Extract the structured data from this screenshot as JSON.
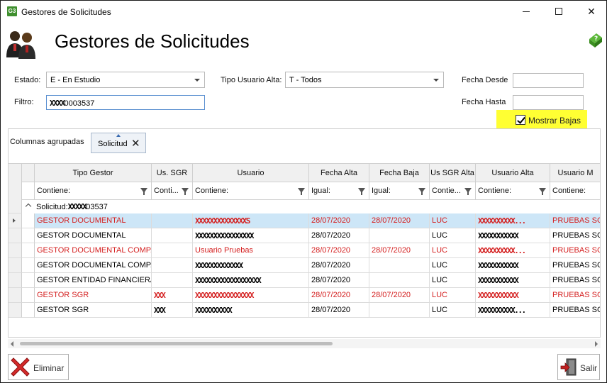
{
  "window": {
    "app_icon_text": "G3",
    "title": "Gestores de Solicitudes"
  },
  "header": {
    "title": "Gestores de Solicitudes"
  },
  "filters": {
    "estado_label": "Estado:",
    "estado_value": "E - En Estudio",
    "tipo_usuario_label": "Tipo Usuario Alta:",
    "tipo_usuario_value": "T - Todos",
    "fecha_desde_label": "Fecha Desde",
    "fecha_desde_value": "",
    "fecha_hasta_label": "Fecha Hasta",
    "fecha_hasta_value": "",
    "filtro_label": "Filtro:",
    "filtro_value_redacted": "XXXX",
    "filtro_value": "0003537",
    "mostrar_bajas_label": "Mostrar Bajas",
    "mostrar_bajas_checked": true
  },
  "grouping": {
    "label": "Columnas agrupadas",
    "chip_label": "Solicitud",
    "group_row_label": "Solicitud:",
    "group_row_redacted": "XXXXX",
    "group_row_value": "03537"
  },
  "grid": {
    "columns": [
      {
        "header": "Tipo Gestor",
        "filter": "Contiene:"
      },
      {
        "header": "Us. SGR",
        "filter": "Conti..."
      },
      {
        "header": "Usuario",
        "filter": "Contiene:"
      },
      {
        "header": "Fecha Alta",
        "filter": "Igual:"
      },
      {
        "header": "Fecha Baja",
        "filter": "Igual:"
      },
      {
        "header": "Us SGR Alta",
        "filter": "Contie..."
      },
      {
        "header": "Usuario Alta",
        "filter": "Contiene:"
      },
      {
        "header": "Usuario M",
        "filter": "Contiene:"
      }
    ],
    "rows": [
      {
        "tipo_gestor": "GESTOR DOCUMENTAL",
        "us_sgr": "",
        "usuario": "XXXXXXXXXXXXXXS",
        "fecha_alta": "28/07/2020",
        "fecha_baja": "28/07/2020",
        "us_sgr_alta": "LUC",
        "usuario_alta": "XXXXXXXXXX...",
        "usuario_m": "PRUEBAS SGR",
        "red": true,
        "selected": true
      },
      {
        "tipo_gestor": "GESTOR DOCUMENTAL",
        "us_sgr": "",
        "usuario": "XXXXXXXXXXXXXXXX",
        "fecha_alta": "28/07/2020",
        "fecha_baja": "",
        "us_sgr_alta": "LUC",
        "usuario_alta": "XXXXXXXXXXX",
        "usuario_m": "PRUEBAS SGR",
        "red": false,
        "selected": false
      },
      {
        "tipo_gestor": "GESTOR DOCUMENTAL COMP...",
        "us_sgr": "",
        "usuario": "Usuario Pruebas",
        "fecha_alta": "28/07/2020",
        "fecha_baja": "28/07/2020",
        "us_sgr_alta": "LUC",
        "usuario_alta": "XXXXXXXXXX...",
        "usuario_m": "PRUEBAS SGR",
        "red": true,
        "selected": false
      },
      {
        "tipo_gestor": "GESTOR DOCUMENTAL COMP...",
        "us_sgr": "",
        "usuario": "XXXXXXXXXXXXX",
        "fecha_alta": "28/07/2020",
        "fecha_baja": "",
        "us_sgr_alta": "LUC",
        "usuario_alta": "XXXXXXXXXXX",
        "usuario_m": "PRUEBAS SGR",
        "red": false,
        "selected": false
      },
      {
        "tipo_gestor": "GESTOR ENTIDAD FINANCIERA",
        "us_sgr": "",
        "usuario": "XXXXXXXXXXXXXXXXXX",
        "fecha_alta": "28/07/2020",
        "fecha_baja": "",
        "us_sgr_alta": "LUC",
        "usuario_alta": "XXXXXXXXXXX",
        "usuario_m": "PRUEBAS SGR",
        "red": false,
        "selected": false
      },
      {
        "tipo_gestor": "GESTOR SGR",
        "us_sgr": "XXX",
        "usuario": "XXXXXXXXXXXXXXXX",
        "fecha_alta": "28/07/2020",
        "fecha_baja": "28/07/2020",
        "us_sgr_alta": "LUC",
        "usuario_alta": "XXXXXXXXXXX",
        "usuario_m": "PRUEBAS SGR",
        "red": true,
        "selected": false
      },
      {
        "tipo_gestor": "GESTOR SGR",
        "us_sgr": "XXX",
        "usuario": "XXXXXXXXXX",
        "fecha_alta": "28/07/2020",
        "fecha_baja": "",
        "us_sgr_alta": "LUC",
        "usuario_alta": "XXXXXXXXXX...",
        "usuario_m": "PRUEBAS SGR",
        "red": false,
        "selected": false
      }
    ]
  },
  "footer": {
    "eliminar_label": "Eliminar",
    "salir_label": "Salir"
  },
  "colors": {
    "deleted_row_text": "#d42020",
    "selected_row_bg": "#cde6f7",
    "highlight": "#ffff33"
  }
}
